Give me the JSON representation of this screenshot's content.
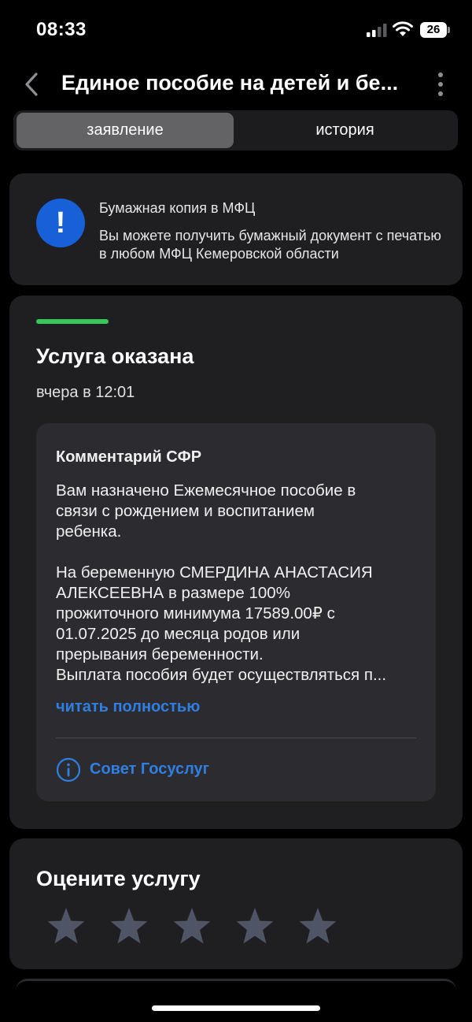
{
  "status_bar": {
    "time": "08:33",
    "battery": "26"
  },
  "header": {
    "title": "Единое пособие на детей и бе..."
  },
  "tabs": [
    {
      "label": "заявление"
    },
    {
      "label": "история"
    }
  ],
  "info": {
    "title": "Бумажная копия в МФЦ",
    "text": "Вы можете получить бумажный документ с печатью в любом МФЦ Кемеровской области"
  },
  "status": {
    "title": "Услуга оказана",
    "date": "вчера в 12:01",
    "accent_color": "#34c759"
  },
  "comment": {
    "title": "Комментарий СФР",
    "p1": "Вам назначено Ежемесячное пособие в\nсвязи с рождением и воспитанием\nребенка.",
    "p2_lines": [
      "На беременную СМЕРДИНА АНАСТАСИЯ",
      "АЛЕКСЕЕВНА в размере 100%",
      "прожиточного минимума 17589.00₽ с",
      "01.07.2025 до месяца родов или",
      "прерывания беременности.",
      "Выплата пособия будет осуществляться п..."
    ],
    "read_more": "читать полностью",
    "advice": "Совет Госуслуг",
    "link_color": "#2f7fe3"
  },
  "rating": {
    "title": "Оцените услугу",
    "stars_total": 5,
    "stars_selected": 0
  }
}
